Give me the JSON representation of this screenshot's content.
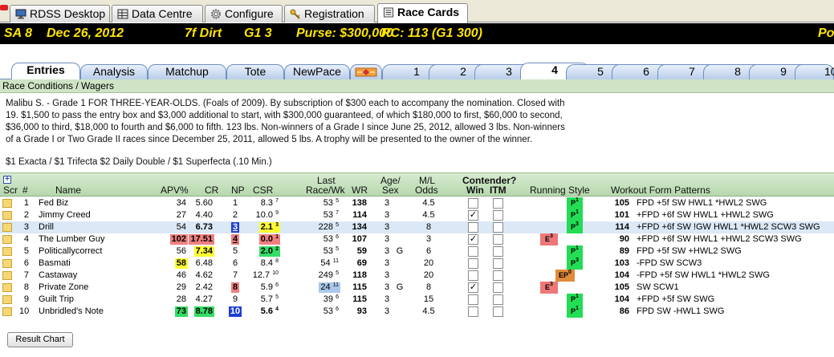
{
  "app_tabs": [
    {
      "label": "RDSS Desktop",
      "icon": "monitor-icon"
    },
    {
      "label": "Data Centre",
      "icon": "database-icon"
    },
    {
      "label": "Configure",
      "icon": "gear-icon"
    },
    {
      "label": "Registration",
      "icon": "key-icon"
    },
    {
      "label": "Race Cards",
      "icon": "racecard-icon",
      "active": true
    }
  ],
  "race_header": {
    "track_race": "SA  8",
    "date": "Dec 26, 2012",
    "distance_surface": "7f  Dirt",
    "grade_field": "G1  3",
    "purse": "Purse: $300,000",
    "rc": "RC: 113  (G1 300)",
    "overflow": "Po"
  },
  "sub_tabs": [
    "Entries",
    "Analysis",
    "Matchup",
    "Tote",
    "NewPace",
    "1",
    "2",
    "3",
    "4",
    "5",
    "6",
    "7",
    "8",
    "9",
    "10"
  ],
  "section_title": "Race Conditions / Wagers",
  "conditions_lines": [
    "Malibu S. - Grade 1 FOR THREE-YEAR-OLDS.  (Foals of 2009).  By subscription of $300 each to accompany the nomination.  Closed with",
    "19.  $1,500 to pass the entry box and $3,000 additional to start, with $300,000 guaranteed, of which $180,000 to first, $60,000 to second,",
    "$36,000 to third, $18,000 to fourth and $6,000 to fifth. 123 lbs. Non-winners of a Grade I since June 25, 2012, allowed 3 lbs.  Non-winners",
    "of a Grade I or Two Grade II races since December 25, 2011, allowed 5 lbs.  A trophy will be presented to the owner of the winner."
  ],
  "wagers": "$1 Exacta / $1 Trifecta $2 Daily Double / $1 Superfecta (.10 Min.)",
  "columns": {
    "plus": "+",
    "scr": "Scr",
    "num": "#",
    "name": "Name",
    "apv": "APV%",
    "cr": "CR",
    "np": "NP",
    "csr": "CSR",
    "last1": "Last",
    "last2": "Race/Wk",
    "wr": "WR",
    "agesex1": "Age/",
    "agesex2": "Sex",
    "ml1": "M/L",
    "ml2": "Odds",
    "contender": "Contender?",
    "win": "Win",
    "itm": "ITM",
    "running_style": "Running Style",
    "workout": "Workout Form Patterns"
  },
  "entries": [
    {
      "num": "1",
      "name": "Fed Biz",
      "apv": "34",
      "cr": "5.60",
      "np": "1",
      "csr": "8.3",
      "csr_sup": "7",
      "last": "53",
      "last_sup": "5",
      "wr": "138",
      "age": "3",
      "sex": "",
      "ml": "4.5",
      "win": "",
      "itm": "",
      "rs": "P",
      "rs_sup": "1",
      "wfp_num": "105",
      "wfp": "FPD  +5f  SW  HWL1  *HWL2  SWG"
    },
    {
      "num": "2",
      "name": "Jimmy Creed",
      "apv": "27",
      "cr": "4.40",
      "np": "2",
      "csr": "10.0",
      "csr_sup": "9",
      "last": "53",
      "last_sup": "7",
      "wr": "114",
      "age": "3",
      "sex": "",
      "ml": "4.5",
      "win": "✓",
      "itm": "",
      "rs": "P",
      "rs_sup": "1",
      "wfp_num": "101",
      "wfp": "+FPD  +6f  SW  HWL1  +HWL2  SWG"
    },
    {
      "num": "3",
      "name": "Drill",
      "apv": "54",
      "cr": "6.73",
      "np": "3",
      "csr": "2.1",
      "csr_sup": "3",
      "last": "228",
      "last_sup": "5",
      "wr": "134",
      "age": "3",
      "sex": "",
      "ml": "8",
      "win": "",
      "itm": "",
      "rs": "P",
      "rs_sup": "3",
      "wfp_num": "114",
      "wfp": "+FPD  +6f  SW  !GW  HWL1  *HWL2  SCW3  SWG"
    },
    {
      "num": "4",
      "name": "The Lumber Guy",
      "apv": "102",
      "cr": "17.51",
      "np": "4",
      "csr": "0.0",
      "csr_sup": "1",
      "last": "53",
      "last_sup": "6",
      "wr": "107",
      "age": "3",
      "sex": "",
      "ml": "3",
      "win": "✓",
      "itm": "",
      "rs": "E",
      "rs_sup": "3",
      "wfp_num": "90",
      "wfp": "+FPD  +6f  SW  HWL1  +HWL2  SCW3  SWG"
    },
    {
      "num": "5",
      "name": "Politicallycorrect",
      "apv": "56",
      "cr": "7.34",
      "np": "5",
      "csr": "2.0",
      "csr_sup": "2",
      "last": "53",
      "last_sup": "5",
      "wr": "59",
      "age": "3",
      "sex": "G",
      "ml": "6",
      "win": "",
      "itm": "",
      "rs": "P",
      "rs_sup": "1",
      "wfp_num": "89",
      "wfp": "FPD  +5f  SW  +HWL2  SWG"
    },
    {
      "num": "6",
      "name": "Basmati",
      "apv": "58",
      "cr": "6.48",
      "np": "6",
      "csr": "8.4",
      "csr_sup": "8",
      "last": "54",
      "last_sup": "11",
      "wr": "69",
      "age": "3",
      "sex": "",
      "ml": "20",
      "win": "",
      "itm": "",
      "rs": "P",
      "rs_sup": "3",
      "wfp_num": "103",
      "wfp": "-FPD  SW  SCW3"
    },
    {
      "num": "7",
      "name": "Castaway",
      "apv": "46",
      "cr": "4.62",
      "np": "7",
      "csr": "12.7",
      "csr_sup": "10",
      "last": "249",
      "last_sup": "5",
      "wr": "118",
      "age": "3",
      "sex": "",
      "ml": "20",
      "win": "",
      "itm": "",
      "rs": "EP",
      "rs_sup": "0",
      "wfp_num": "104",
      "wfp": "-FPD  +5f  SW  HWL1  *HWL2  SWG"
    },
    {
      "num": "8",
      "name": "Private Zone",
      "apv": "29",
      "cr": "2.42",
      "np": "8",
      "csr": "5.9",
      "csr_sup": "6",
      "last": "24",
      "last_sup": "11",
      "wr": "115",
      "age": "3",
      "sex": "G",
      "ml": "8",
      "win": "✓",
      "itm": "",
      "rs": "E",
      "rs_sup": "3",
      "wfp_num": "105",
      "wfp": "SW  SCW1"
    },
    {
      "num": "9",
      "name": "Guilt Trip",
      "apv": "28",
      "cr": "4.27",
      "np": "9",
      "csr": "5.7",
      "csr_sup": "5",
      "last": "39",
      "last_sup": "6",
      "wr": "115",
      "age": "3",
      "sex": "",
      "ml": "15",
      "win": "",
      "itm": "",
      "rs": "P",
      "rs_sup": "1",
      "wfp_num": "104",
      "wfp": "+FPD  +5f  SW  SWG"
    },
    {
      "num": "10",
      "name": "Unbridled's Note",
      "apv": "73",
      "cr": "8.78",
      "np": "10",
      "csr": "5.6",
      "csr_sup": "4",
      "last": "53",
      "last_sup": "6",
      "wr": "93",
      "age": "3",
      "sex": "",
      "ml": "4.5",
      "win": "",
      "itm": "",
      "rs": "P",
      "rs_sup": "1",
      "wfp_num": "86",
      "wfp": "FPD  SW  -HWL1  SWG"
    }
  ],
  "highlights": {
    "apv": {
      "3": "#f08080",
      "5": "#ffff33",
      "9": "#33dd66"
    },
    "cr": {
      "3": "#f08080",
      "4": "#ffff33",
      "9": "#33dd66"
    },
    "np": {
      "2": "#1f3fd0",
      "3": "#f08080",
      "7": "#f08080",
      "9": "#1f3fd0"
    },
    "csr": {
      "2": "#ffff33",
      "3": "#f08080",
      "4": "#33dd66"
    },
    "last": {
      "7": "#a9c8ec"
    },
    "rs_colors": {
      "P": "#22dd55",
      "E": "#ee7777",
      "EP": "#e08a3a"
    }
  },
  "result_chart_button": "Result Chart"
}
